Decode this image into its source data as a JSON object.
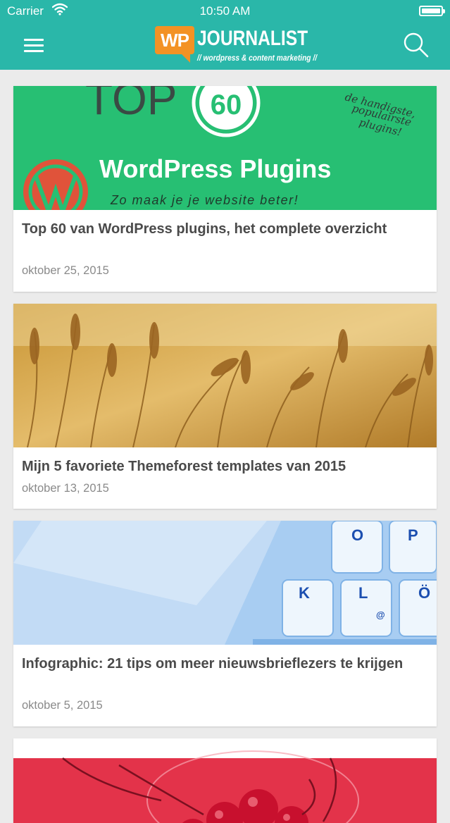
{
  "status_bar": {
    "carrier": "Carrier",
    "time": "10:50 AM"
  },
  "header": {
    "logo_badge": "WP",
    "logo_name": "JOURNALIST",
    "logo_tagline": "// wordpress & content marketing //"
  },
  "posts": [
    {
      "title": "Top 60 van WordPress plugins, het complete overzicht",
      "date": "oktober 25, 2015",
      "image": {
        "heading_text": "TOP",
        "number": "60",
        "banner": "WordPress Plugins",
        "subline": "Zo maak je je website beter!",
        "handwriting": [
          "de handigste,",
          "populairste",
          "plugins!"
        ]
      }
    },
    {
      "title": "Mijn 5 favoriete Themeforest templates van 2015",
      "date": "oktober 13, 2015"
    },
    {
      "title": "Infographic: 21 tips om meer nieuwsbrieflezers te krijgen",
      "date": "oktober 5, 2015",
      "image": {
        "keys": [
          "O",
          "P",
          "K",
          "L",
          "Ö",
          "@"
        ]
      }
    },
    {
      "title": "",
      "date": ""
    }
  ],
  "colors": {
    "header": "#2ab7a9",
    "logo_orange": "#f39224",
    "card_title": "#4a4a4a",
    "card_date": "#8a8a8a",
    "banner_green": "#27bf73"
  }
}
